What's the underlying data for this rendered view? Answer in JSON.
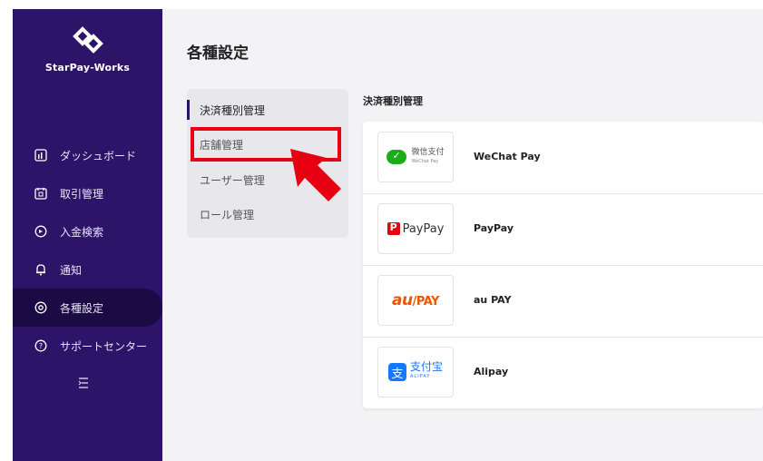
{
  "brand": {
    "name": "StarPay-Works"
  },
  "sidebar": {
    "items": [
      {
        "label": "ダッシュボード",
        "icon": "dashboard-icon"
      },
      {
        "label": "取引管理",
        "icon": "transaction-icon"
      },
      {
        "label": "入金検索",
        "icon": "deposit-search-icon"
      },
      {
        "label": "通知",
        "icon": "bell-icon"
      },
      {
        "label": "各種設定",
        "icon": "settings-icon",
        "active": true
      },
      {
        "label": "サポートセンター",
        "icon": "help-icon"
      }
    ],
    "collapse_icon": "menu-collapse-icon"
  },
  "page": {
    "title": "各種設定"
  },
  "subnav": {
    "items": [
      {
        "label": "決済種別管理",
        "active": true
      },
      {
        "label": "店舗管理",
        "highlighted": true
      },
      {
        "label": "ユーザー管理"
      },
      {
        "label": "ロール管理"
      }
    ]
  },
  "payments": {
    "section_label": "決済種別管理",
    "methods": [
      {
        "name": "WeChat Pay",
        "logo_text": "微信支付",
        "logo_sub": "WeChat Pay"
      },
      {
        "name": "PayPay",
        "logo_text": "PayPay"
      },
      {
        "name": "au PAY",
        "logo_text": "au",
        "logo_text2": "PAY"
      },
      {
        "name": "Alipay",
        "logo_text": "支付宝",
        "logo_sub": "ALIPAY",
        "logo_mark": "支"
      }
    ]
  },
  "colors": {
    "sidebar_bg": "#2d1468",
    "highlight": "#e60012",
    "wechat": "#1aad19",
    "paypay": "#e60012",
    "aupay": "#eb5505",
    "alipay": "#1677ff"
  }
}
